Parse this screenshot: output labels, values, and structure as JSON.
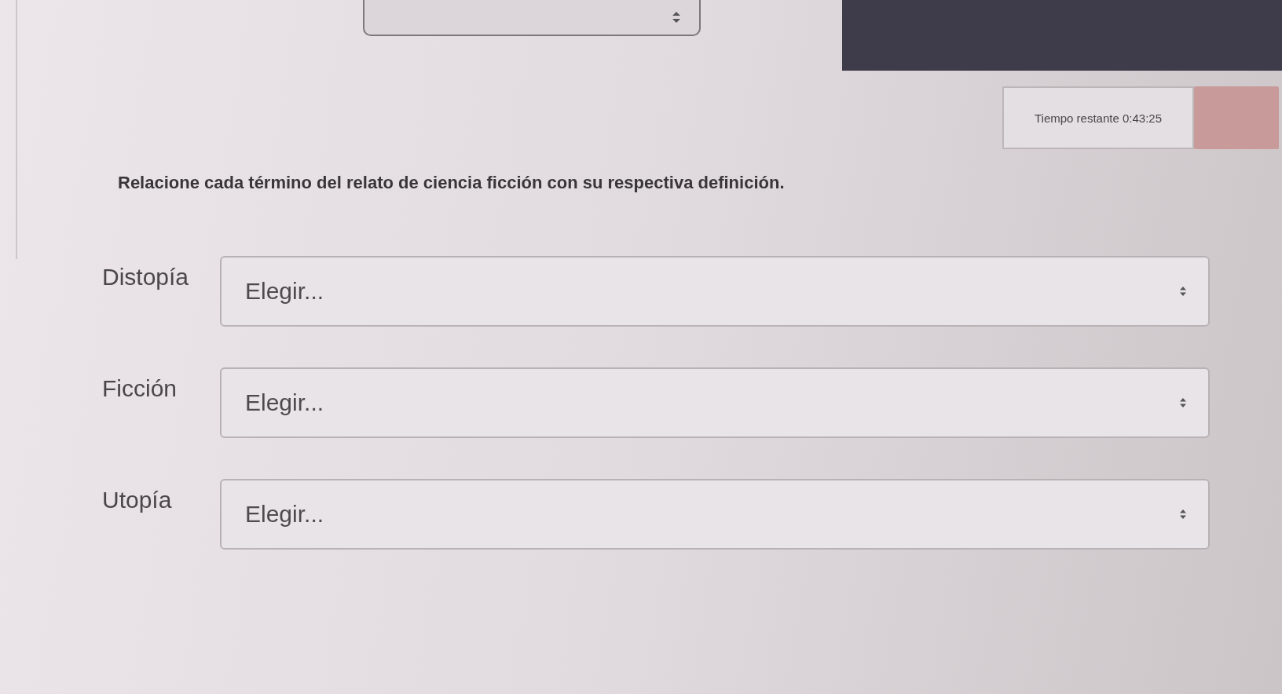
{
  "timer": {
    "text": "Tiempo restante 0:43:25"
  },
  "instruction": "Relacione cada término del relato de ciencia ficción con su respectiva definición.",
  "matches": [
    {
      "term": "Distopía",
      "value": "Elegir..."
    },
    {
      "term": "Ficción",
      "value": "Elegir..."
    },
    {
      "term": "Utopía",
      "value": "Elegir..."
    }
  ]
}
